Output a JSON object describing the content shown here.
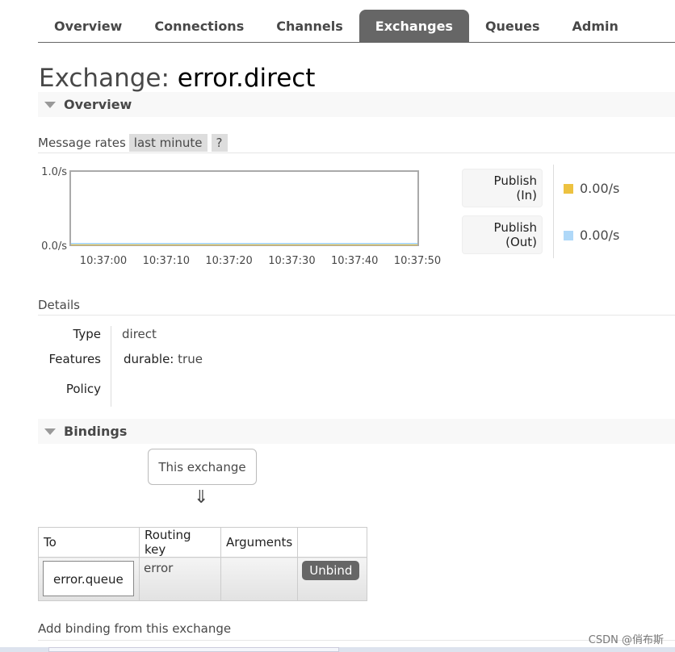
{
  "nav": {
    "tabs": [
      {
        "label": "Overview",
        "active": false
      },
      {
        "label": "Connections",
        "active": false
      },
      {
        "label": "Channels",
        "active": false
      },
      {
        "label": "Exchanges",
        "active": true
      },
      {
        "label": "Queues",
        "active": false
      },
      {
        "label": "Admin",
        "active": false
      }
    ]
  },
  "page": {
    "title_prefix": "Exchange: ",
    "exchange_name": "error.direct"
  },
  "overview": {
    "section_label": "Overview",
    "message_rates_label": "Message rates",
    "range_label": "last minute",
    "help_label": "?"
  },
  "chart_data": {
    "type": "area",
    "y_ticks": [
      "1.0/s",
      "0.0/s"
    ],
    "ylim": [
      0,
      1.0
    ],
    "x_ticks": [
      "10:37:00",
      "10:37:10",
      "10:37:20",
      "10:37:30",
      "10:37:40",
      "10:37:50"
    ],
    "series": [
      {
        "name": "Publish (In)",
        "color": "#edc240",
        "values": [
          0,
          0,
          0,
          0,
          0,
          0
        ]
      },
      {
        "name": "Publish (Out)",
        "color": "#afd8f8",
        "values": [
          0,
          0,
          0,
          0,
          0,
          0
        ]
      }
    ]
  },
  "legend": [
    {
      "line1": "Publish",
      "line2": "(In)",
      "value": "0.00/s",
      "color": "#edc240"
    },
    {
      "line1": "Publish",
      "line2": "(Out)",
      "value": "0.00/s",
      "color": "#afd8f8"
    }
  ],
  "details": {
    "section_label": "Details",
    "type_label": "Type",
    "type_value": "direct",
    "features_label": "Features",
    "feature_key": "durable:",
    "feature_value": "true",
    "policy_label": "Policy"
  },
  "bindings": {
    "section_label": "Bindings",
    "source_label": "This exchange",
    "arrow": "⇓",
    "columns": [
      "To",
      "Routing key",
      "Arguments",
      ""
    ],
    "rows": [
      {
        "to": "error.queue",
        "routing_key": "error",
        "arguments": "",
        "action": "Unbind"
      }
    ]
  },
  "add_binding": {
    "label": "Add binding from this exchange"
  },
  "watermark": "CSDN @俏布斯"
}
